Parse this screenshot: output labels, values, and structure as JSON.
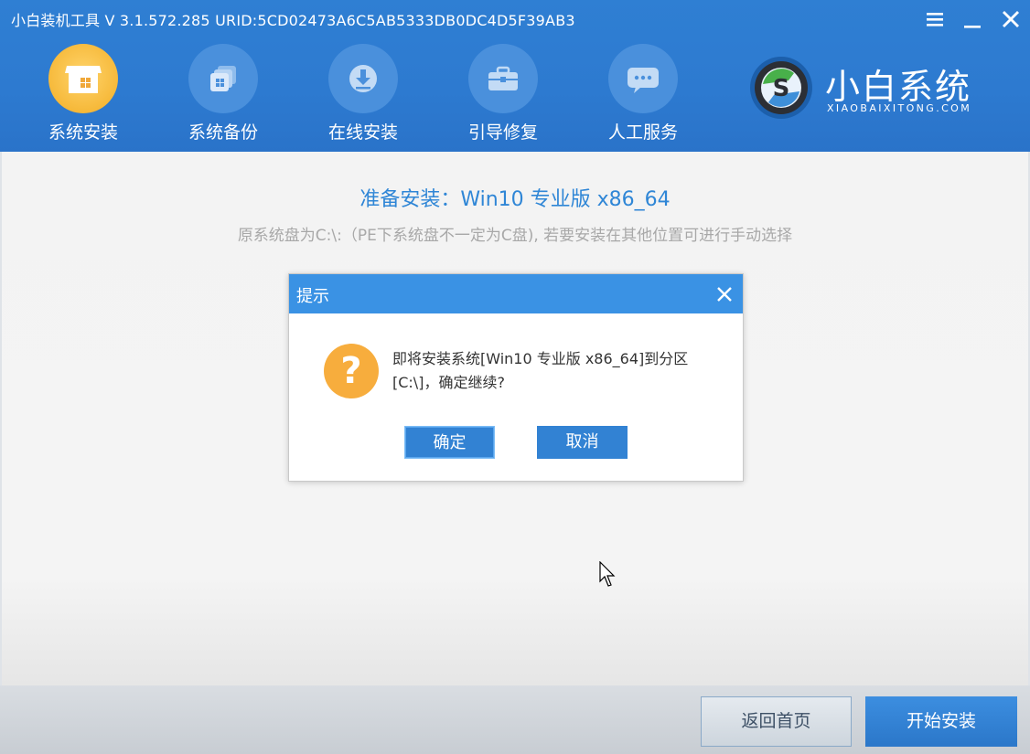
{
  "window": {
    "title": "小白装机工具 V 3.1.572.285 URID:5CD02473A6C5AB5333DB0DC4D5F39AB3",
    "controls": [
      "menu-icon",
      "minimize-icon",
      "close-icon"
    ]
  },
  "nav": {
    "items": [
      {
        "label": "系统安装",
        "icon": "windows-box-icon",
        "active": true
      },
      {
        "label": "系统备份",
        "icon": "backup-icon",
        "active": false
      },
      {
        "label": "在线安装",
        "icon": "download-icon",
        "active": false
      },
      {
        "label": "引导修复",
        "icon": "toolbox-icon",
        "active": false
      },
      {
        "label": "人工服务",
        "icon": "chat-icon",
        "active": false
      }
    ]
  },
  "brand": {
    "name": "小白系统",
    "subtitle": "XIAOBAIXITONG.COM"
  },
  "main": {
    "title": "准备安装：Win10 专业版 x86_64",
    "hint": "原系统盘为C:\\:（PE下系统盘不一定为C盘), 若要安装在其他位置可进行手动选择"
  },
  "dialog": {
    "title": "提示",
    "message_line1": "即将安装系统[Win10 专业版 x86_64]到分区",
    "message_line2": "[C:\\]，确定继续?",
    "ok_label": "确定",
    "cancel_label": "取消",
    "icon": "question-icon"
  },
  "footer": {
    "back_label": "返回首页",
    "start_label": "开始安装"
  },
  "colors": {
    "header_blue": "#2d7ad0",
    "accent_blue": "#2f86d6",
    "active_orange": "#f6b93a",
    "question_orange": "#f7ad3d"
  }
}
